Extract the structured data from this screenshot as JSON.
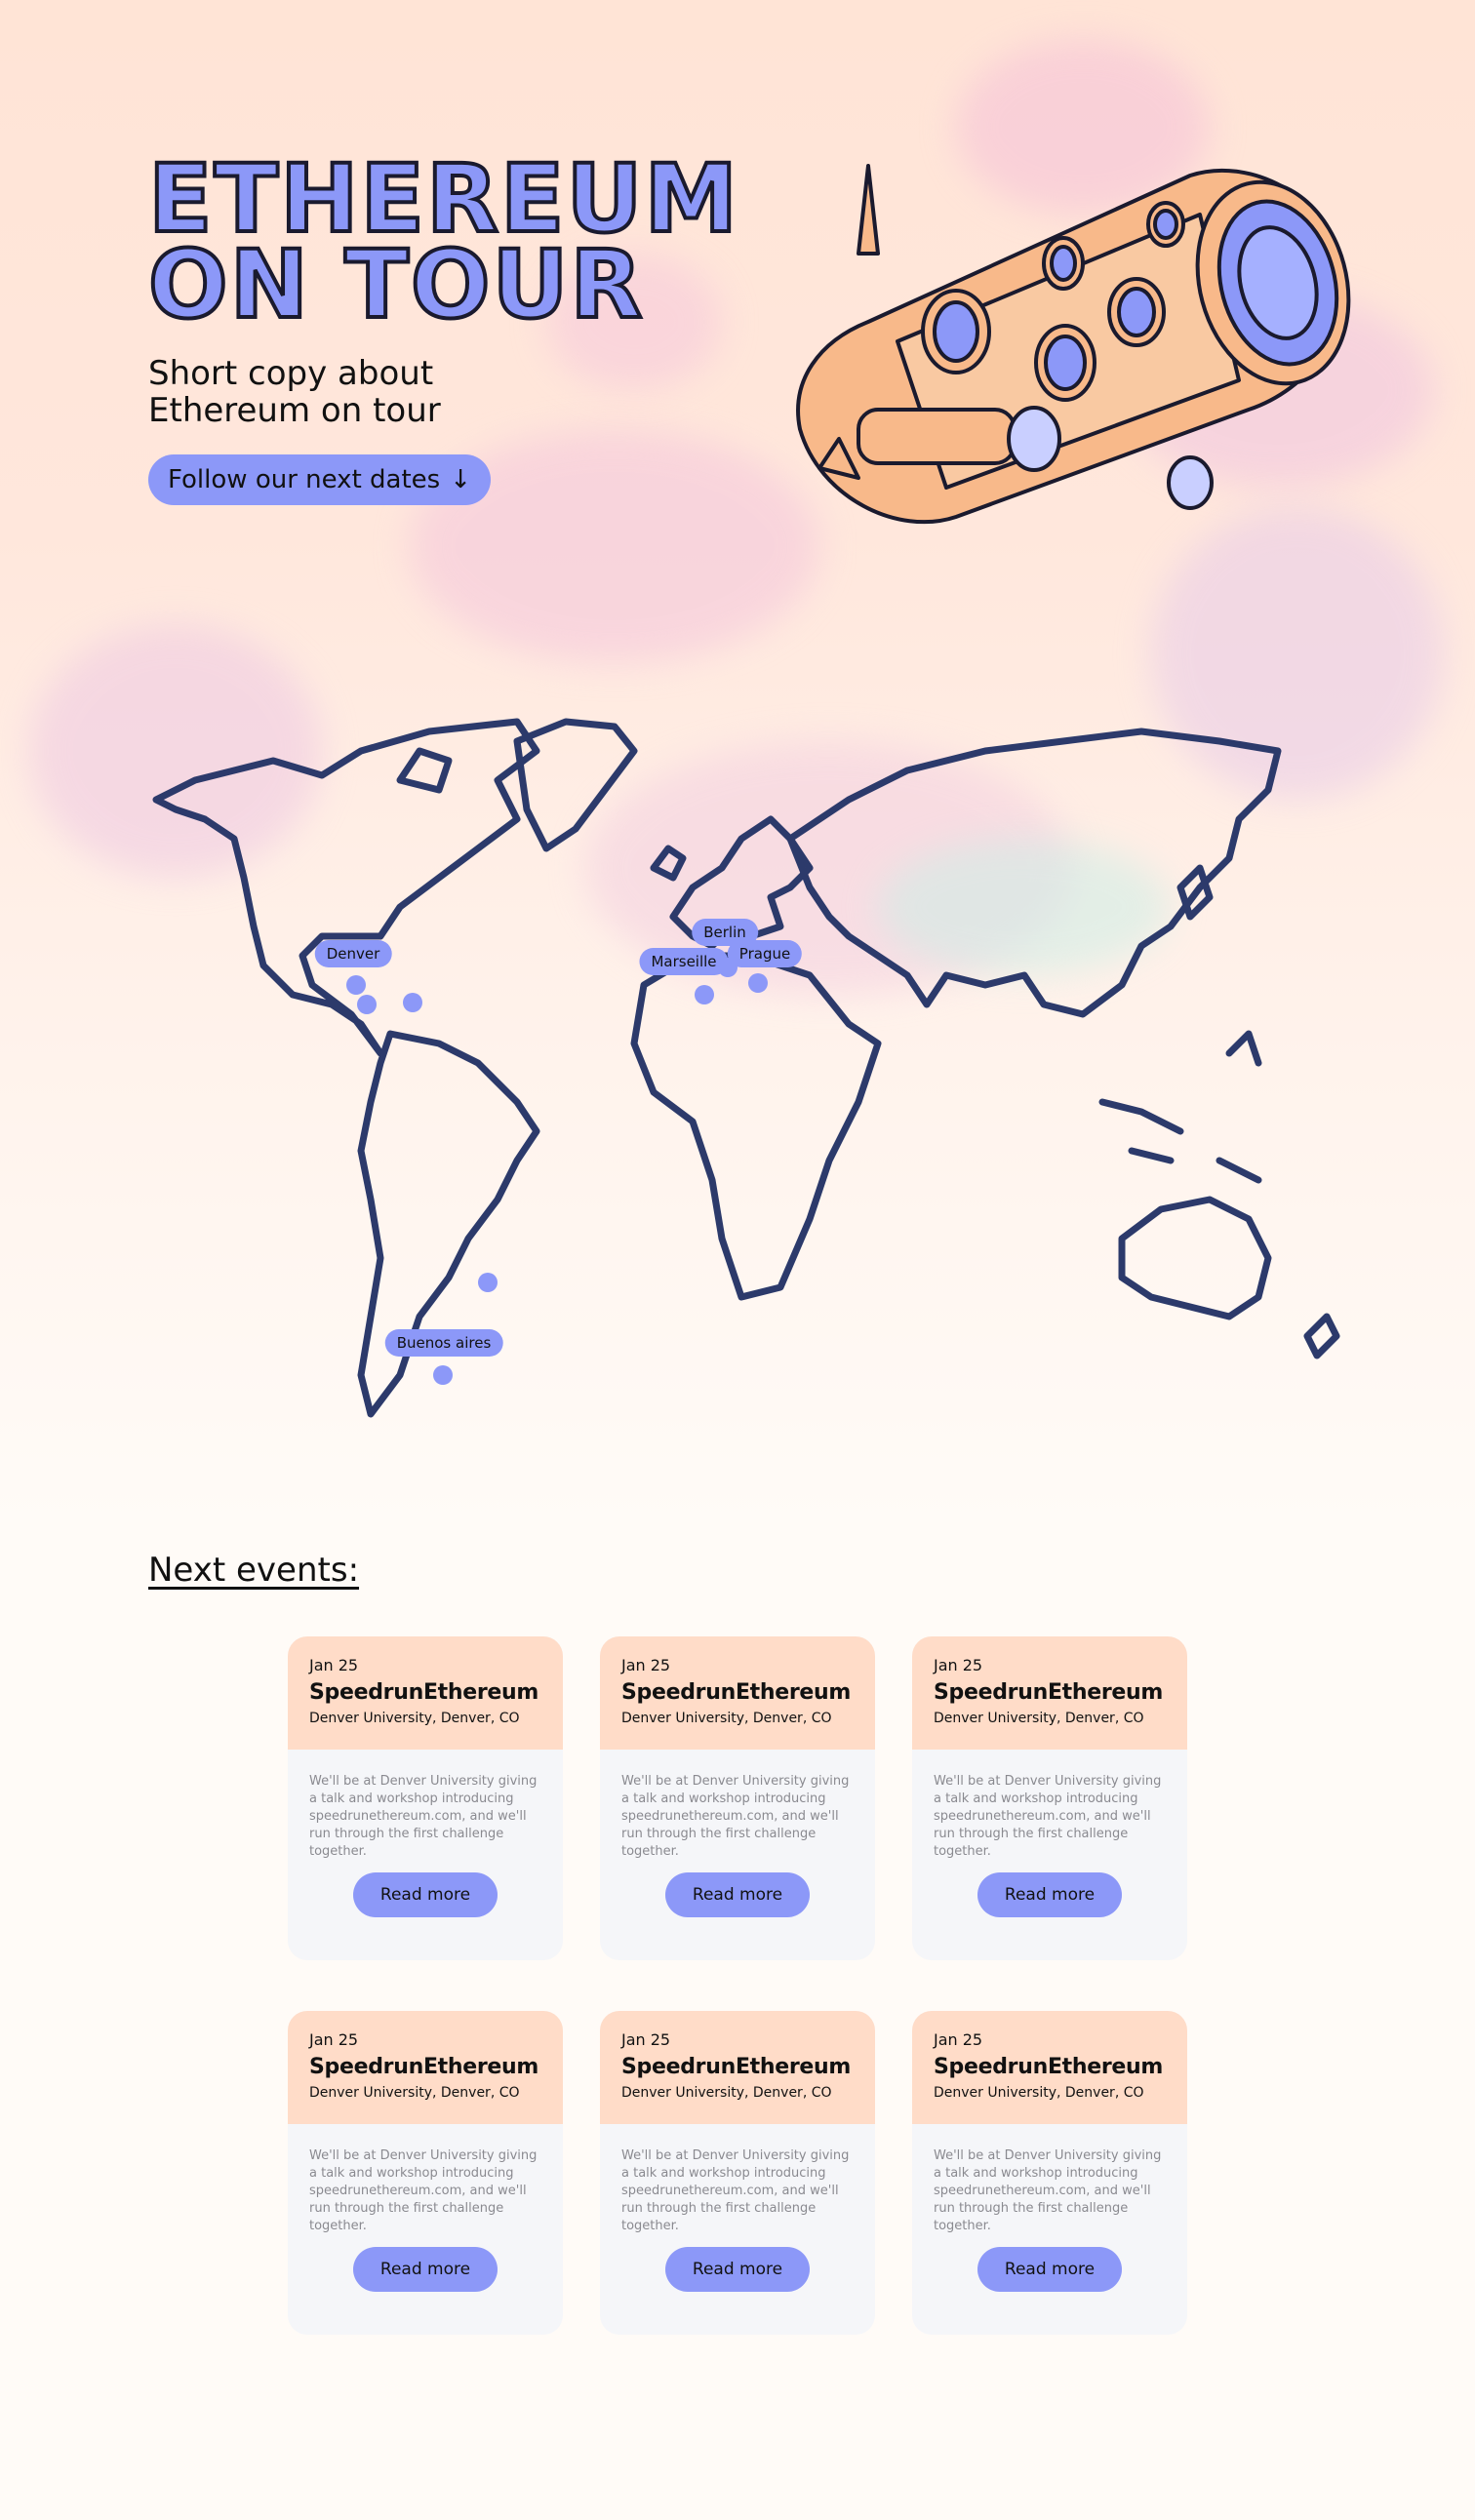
{
  "hero": {
    "title_line1": "Ethereum",
    "title_line2": "on tour",
    "copy": "Short copy about Ethereum on tour",
    "cta_label": "Follow our next dates",
    "cta_icon": "↓"
  },
  "map": {
    "labels": {
      "denver": "Denver",
      "berlin": "Berlin",
      "marseille": "Marseille",
      "prague": "Prague",
      "buenos_aires": "Buenos aires"
    }
  },
  "events": {
    "title": "Next events:",
    "items": [
      {
        "date": "Jan 25",
        "title": "SpeedrunEthereum",
        "location": "Denver University, Denver, CO",
        "description": "We'll be at Denver University giving a talk and workshop introducing speedrunethereum.com, and we'll run through the first challenge together.",
        "button": "Read more"
      },
      {
        "date": "Jan 25",
        "title": "SpeedrunEthereum",
        "location": "Denver University, Denver, CO",
        "description": "We'll be at Denver University giving a talk and workshop introducing speedrunethereum.com, and we'll run through the first challenge together.",
        "button": "Read more"
      },
      {
        "date": "Jan 25",
        "title": "SpeedrunEthereum",
        "location": "Denver University, Denver, CO",
        "description": "We'll be at Denver University giving a talk and workshop introducing speedrunethereum.com, and we'll run through the first challenge together.",
        "button": "Read more"
      },
      {
        "date": "Jan 25",
        "title": "SpeedrunEthereum",
        "location": "Denver University, Denver, CO",
        "description": "We'll be at Denver University giving a talk and workshop introducing speedrunethereum.com, and we'll run through the first challenge together.",
        "button": "Read more"
      },
      {
        "date": "Jan 25",
        "title": "SpeedrunEthereum",
        "location": "Denver University, Denver, CO",
        "description": "We'll be at Denver University giving a talk and workshop introducing speedrunethereum.com, and we'll run through the first challenge together.",
        "button": "Read more"
      },
      {
        "date": "Jan 25",
        "title": "SpeedrunEthereum",
        "location": "Denver University, Denver, CO",
        "description": "We'll be at Denver University giving a talk and workshop introducing speedrunethereum.com, and we'll run through the first challenge together.",
        "button": "Read more"
      }
    ]
  },
  "colors": {
    "accent": "#8c98f8",
    "card_header": "#ffdcc8",
    "card_body": "#f5f6f9",
    "map_outline": "#2c3a6b",
    "ship_orange": "#f8b98a",
    "background": "#fffbf7"
  },
  "icons": {
    "cta": "arrow-down-icon",
    "illustration": "spaceship-illustration",
    "map": "world-map"
  }
}
